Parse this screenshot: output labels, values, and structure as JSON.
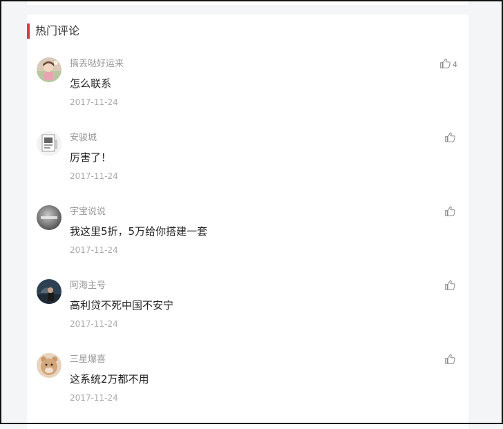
{
  "section": {
    "title": "热门评论"
  },
  "comments": [
    {
      "user": "搞丢哒好运来",
      "text": "怎么联系",
      "date": "2017-11-24",
      "likes": "4"
    },
    {
      "user": "安骏城",
      "text": "厉害了！",
      "date": "2017-11-24",
      "likes": ""
    },
    {
      "user": "宇宝说说",
      "text": "我这里5折，5万给你搭建一套",
      "date": "2017-11-24",
      "likes": ""
    },
    {
      "user": "阿海主号",
      "text": "高利贷不死中国不安宁",
      "date": "2017-11-24",
      "likes": ""
    },
    {
      "user": "三星爆喜",
      "text": "这系统2万都不用",
      "date": "2017-11-24",
      "likes": ""
    }
  ],
  "colors": {
    "accent": "#e33b3b",
    "background": "#f4f5f6"
  }
}
